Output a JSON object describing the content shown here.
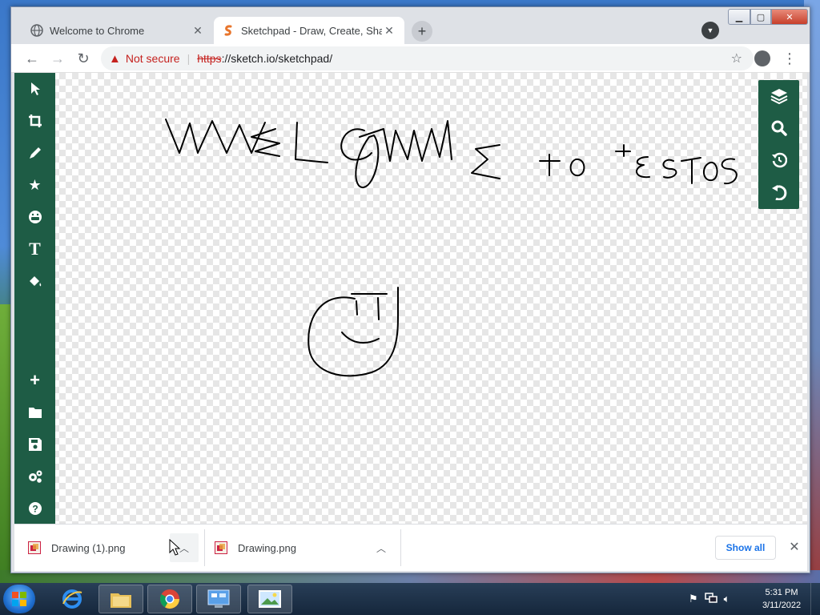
{
  "browser": {
    "tabs": [
      {
        "label": "Welcome to Chrome",
        "active": false,
        "favicon": "globe-icon"
      },
      {
        "label": "Sketchpad - Draw, Create, Share!",
        "active": true,
        "favicon": "sketchpad-logo-icon"
      }
    ],
    "new_tab_label": "+",
    "address": {
      "security_label": "Not secure",
      "scheme": "https",
      "rest": "://sketch.io/sketchpad/"
    }
  },
  "sketchpad": {
    "left_tools": [
      "select-tool",
      "crop-tool",
      "pencil-tool",
      "stamp-tool",
      "emoji-tool",
      "text-tool",
      "fill-tool",
      "add-tool",
      "open-tool",
      "save-tool",
      "settings-tool",
      "help-tool"
    ],
    "right_tools": [
      "layers-tool",
      "zoom-tool",
      "history-tool",
      "undo-tool"
    ],
    "text_tool_glyph": "T",
    "canvas_handwriting": "WELCOME to TESTOS",
    "stroke_color": "#000000",
    "toolbar_color": "#1e5c45"
  },
  "downloads": {
    "items": [
      {
        "filename": "Drawing (1).png"
      },
      {
        "filename": "Drawing.png"
      }
    ],
    "show_all_label": "Show all"
  },
  "taskbar": {
    "apps": [
      "internet-explorer-icon",
      "file-explorer-icon",
      "chrome-icon",
      "control-panel-icon",
      "image-viewer-icon"
    ],
    "time": "5:31 PM",
    "date": "3/11/2022"
  }
}
